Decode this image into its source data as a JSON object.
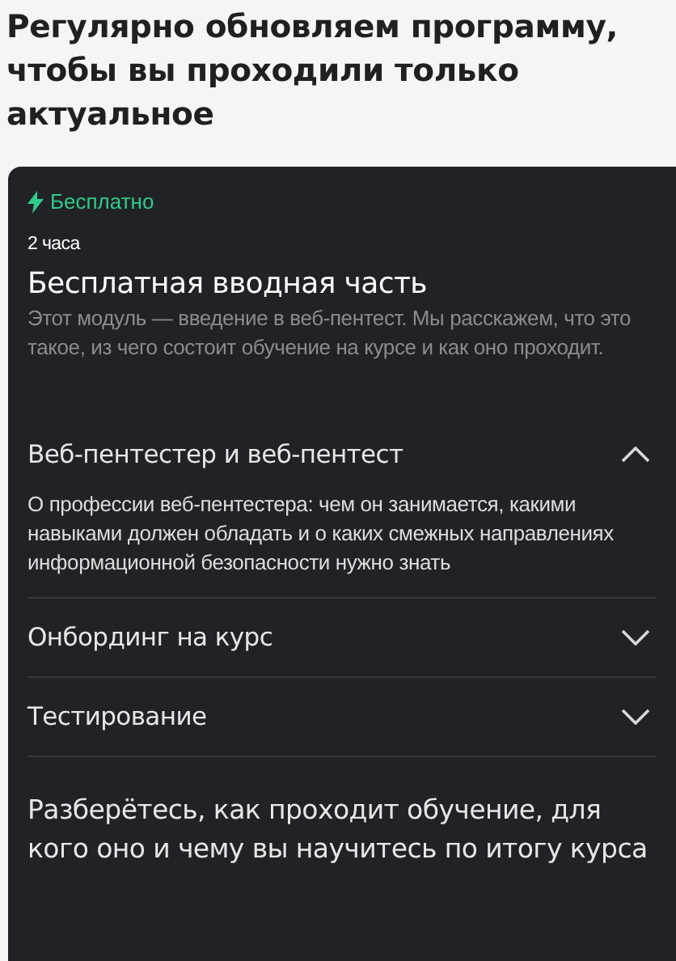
{
  "heading": "Регулярно обновляем программу, чтобы вы проходили только актуальное",
  "module": {
    "badge": "Бесплатно",
    "duration": "2 часа",
    "title": "Бесплатная вводная часть",
    "description": "Этот модуль — введение в веб-пентест. Мы расскажем, что это такое, из чего состоит обучение на курсе и как оно проходит.",
    "topics": [
      {
        "title": "Веб-пентестер и веб-пентест",
        "expanded": true,
        "description": "О профессии веб-пентестера: чем он занимается, какими навыками должен обладать и о каких смежных направлениях информационной безопасности нужно знать"
      },
      {
        "title": "Онбординг на курс",
        "expanded": false
      },
      {
        "title": "Тестирование",
        "expanded": false
      }
    ],
    "summary": "Разберётесь, как проходит обучение, для кого оно и чему вы научитесь по итогу курса"
  }
}
